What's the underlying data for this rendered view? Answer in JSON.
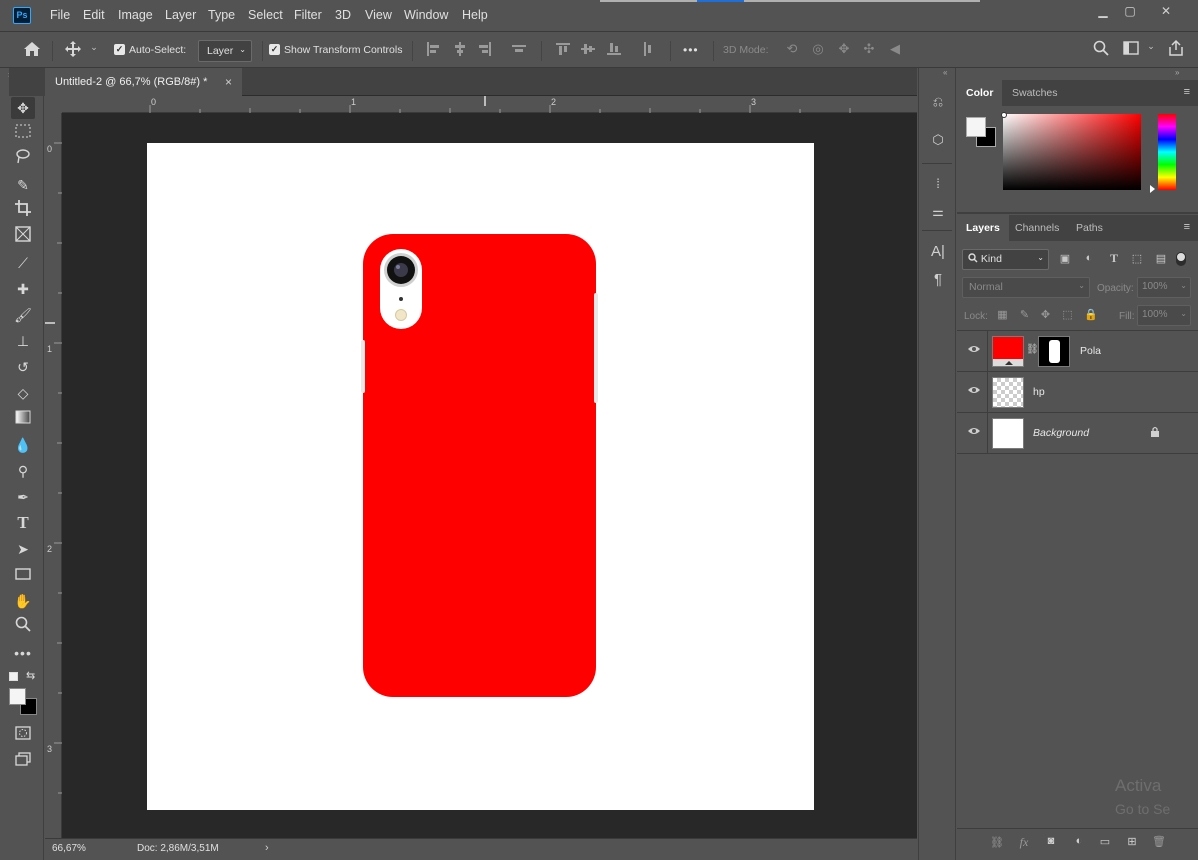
{
  "app": {
    "logo": "Ps"
  },
  "menu": [
    "File",
    "Edit",
    "Image",
    "Layer",
    "Type",
    "Select",
    "Filter",
    "3D",
    "View",
    "Window",
    "Help"
  ],
  "options": {
    "auto_select_label": "Auto-Select:",
    "auto_select_value": "Layer",
    "show_transform_label": "Show Transform Controls",
    "more_label": "•••",
    "mode_3d_label": "3D Mode:"
  },
  "document": {
    "tab_title": "Untitled-2 @ 66,7% (RGB/8#) *",
    "tab_close": "×",
    "ruler_h": [
      "0",
      "1",
      "2",
      "3"
    ],
    "ruler_v": [
      "0",
      "1",
      "2",
      "3"
    ],
    "zoom": "66,67%",
    "doc_size": "Doc: 2,86M/3,51M",
    "case_color": "#ff0000"
  },
  "color_panel": {
    "tabs": [
      "Color",
      "Swatches"
    ],
    "foreground": "#f5f5f5",
    "background": "#000000"
  },
  "layers_panel": {
    "tabs": [
      "Layers",
      "Channels",
      "Paths"
    ],
    "filter_kind": "Kind",
    "blend_mode": "Normal",
    "opacity_label": "Opacity:",
    "opacity_value": "100%",
    "lock_label": "Lock:",
    "fill_label": "Fill:",
    "fill_value": "100%",
    "layers": [
      {
        "name": "Pola"
      },
      {
        "name": "hp"
      },
      {
        "name": "Background"
      }
    ]
  },
  "watermark": {
    "line1": "Activa",
    "line2": "Go to Se"
  }
}
